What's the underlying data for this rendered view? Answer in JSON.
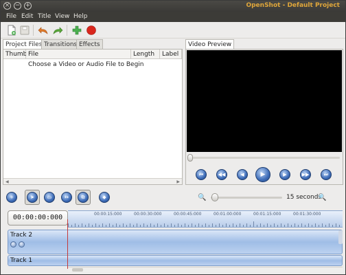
{
  "window": {
    "title": "OpenShot - Default Project",
    "buttons": [
      "close-icon",
      "minimize-icon",
      "maximize-icon"
    ]
  },
  "menu": [
    "File",
    "Edit",
    "Title",
    "View",
    "Help"
  ],
  "toolbar": {
    "icons": [
      "new-project-icon",
      "save-project-icon",
      "undo-icon",
      "redo-icon",
      "import-files-icon",
      "export-video-icon"
    ]
  },
  "left_tabs": [
    "Project Files",
    "Transitions",
    "Effects"
  ],
  "files_table": {
    "columns": [
      "Thumb",
      "File",
      "Length",
      "Label"
    ],
    "empty_message": "Choose a Video or Audio File to Begin"
  },
  "preview": {
    "tab": "Video Preview",
    "controls": [
      "rewind-start-icon",
      "rewind-icon",
      "previous-frame-icon",
      "play-icon",
      "next-frame-icon",
      "fast-forward-icon",
      "jump-end-icon"
    ]
  },
  "timeline": {
    "tools": [
      "add-track-icon",
      "select-tool-icon",
      "razor-tool-icon",
      "resize-tool-icon",
      "snap-tool-icon",
      "add-marker-icon"
    ],
    "zoom_label": "15 seconds",
    "timecode": "00:00:00:000",
    "ruler_labels": [
      "00:00:15:000",
      "00:00:30:000",
      "00:00:45:000",
      "00:01:00:000",
      "00:01:15:000",
      "00:01:30:000"
    ],
    "tracks": [
      "Track 2",
      "Track 1"
    ],
    "colors": {
      "accent": "#dfa63a",
      "track": "#9fbde6",
      "playhead": "#c43a3a"
    }
  }
}
